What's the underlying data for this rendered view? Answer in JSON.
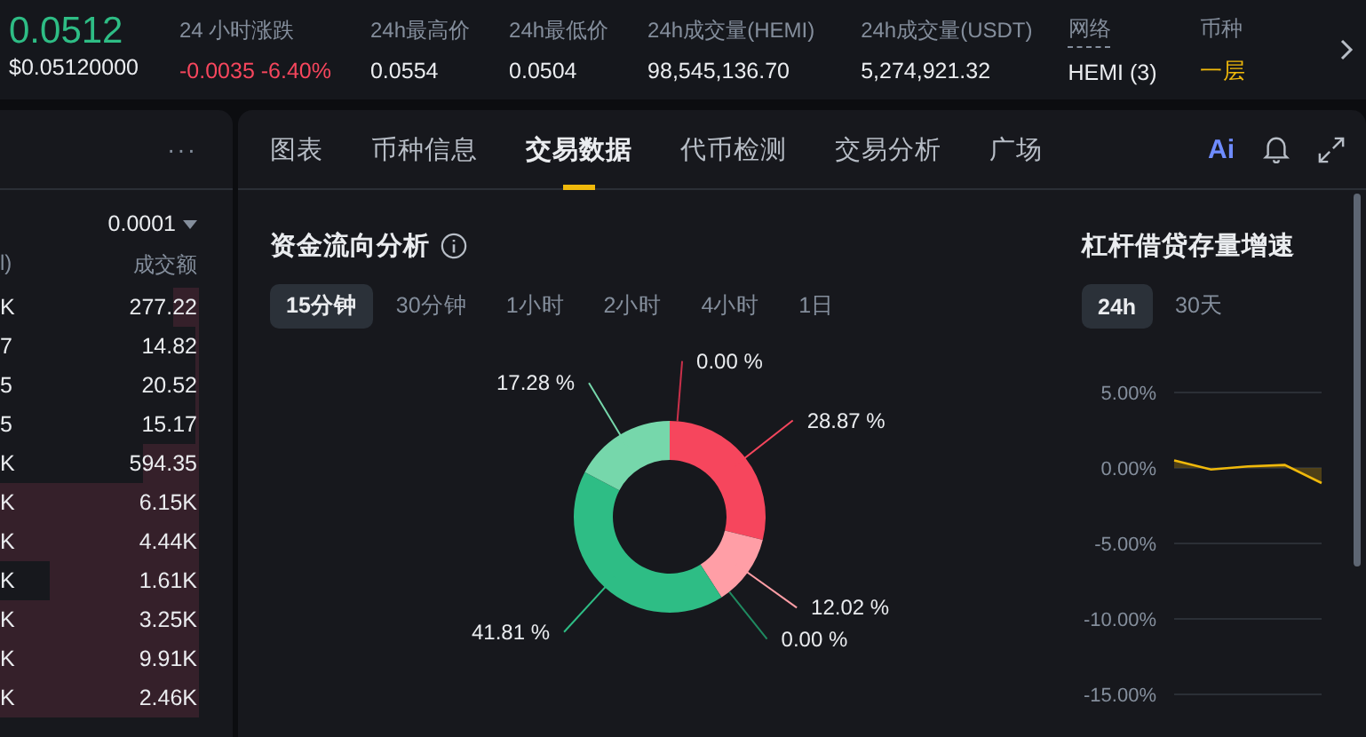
{
  "ticker": {
    "price": "0.0512",
    "price_usd": "$0.05120000"
  },
  "stats": [
    {
      "label": "24 小时涨跌",
      "value": "-0.0035 -6.40%",
      "kind": "down"
    },
    {
      "label": "24h最高价",
      "value": "0.0554",
      "kind": "plain"
    },
    {
      "label": "24h最低价",
      "value": "0.0504",
      "kind": "plain"
    },
    {
      "label": "24h成交量(HEMI)",
      "value": "98,545,136.70",
      "kind": "plain"
    },
    {
      "label": "24h成交量(USDT)",
      "value": "5,274,921.32",
      "kind": "plain"
    },
    {
      "label": "网络",
      "value": "HEMI (3)",
      "kind": "dotted"
    },
    {
      "label": "币种",
      "value": "一层",
      "kind": "accent"
    }
  ],
  "order_book": {
    "more": "···",
    "precision": "0.0001",
    "columns": [
      "l)",
      "成交额"
    ],
    "rows": [
      {
        "column_1": "K",
        "amount": "277.22"
      },
      {
        "column_1": "7",
        "amount": "14.82"
      },
      {
        "column_1": "5",
        "amount": "20.52"
      },
      {
        "column_1": "5",
        "amount": "15.17"
      },
      {
        "column_1": "K",
        "amount": "594.35"
      },
      {
        "column_1": "K",
        "amount": "6.15K"
      },
      {
        "column_1": "K",
        "amount": "4.44K"
      },
      {
        "column_1": "K",
        "amount": "1.61K"
      },
      {
        "column_1": "K",
        "amount": "3.25K"
      },
      {
        "column_1": "K",
        "amount": "9.91K"
      },
      {
        "column_1": "K",
        "amount": "2.46K"
      }
    ]
  },
  "tabs": [
    {
      "label": "图表",
      "selected": false
    },
    {
      "label": "币种信息",
      "selected": false
    },
    {
      "label": "交易数据",
      "selected": true
    },
    {
      "label": "代币检测",
      "selected": false
    },
    {
      "label": "交易分析",
      "selected": false
    },
    {
      "label": "广场",
      "selected": false
    }
  ],
  "ai_button": "Ai",
  "fund_flow": {
    "title": "资金流向分析",
    "periods": [
      {
        "label": "15分钟",
        "selected": true
      },
      {
        "label": "30分钟",
        "selected": false
      },
      {
        "label": "1小时",
        "selected": false
      },
      {
        "label": "2小时",
        "selected": false
      },
      {
        "label": "4小时",
        "selected": false
      },
      {
        "label": "1日",
        "selected": false
      }
    ],
    "chart_data": {
      "type": "donut",
      "value_labels": [
        "0.00 %",
        "28.87 %",
        "12.02 %",
        "0.00 %",
        "41.81 %",
        "17.28 %"
      ],
      "series": [
        {
          "colors": [
            "#c9304a",
            "#f6465d",
            "#ff9ea6",
            "#1f8a60",
            "#2ebd85",
            "#76d7ab"
          ],
          "values": [
            0.0,
            28.87,
            12.02,
            0.0,
            41.81,
            17.28
          ]
        }
      ]
    }
  },
  "margin_growth": {
    "title": "杠杆借贷存量增速",
    "periods": [
      {
        "label": "24h",
        "selected": true
      },
      {
        "label": "30天",
        "selected": false
      }
    ],
    "chart_data": {
      "type": "area",
      "grid": true,
      "ylim": [
        -15,
        5
      ],
      "yticks": [
        {
          "value": 5,
          "label": "5.00%"
        },
        {
          "value": 0,
          "label": "0.00%"
        },
        {
          "value": -5,
          "label": "-5.00%"
        },
        {
          "value": -10,
          "label": "-10.00%"
        },
        {
          "value": -15,
          "label": "-15.00%"
        }
      ],
      "series": [
        {
          "color": "#f0b90b",
          "values": [
            0.5,
            -0.1,
            0.1,
            0.2,
            -1.0
          ]
        }
      ]
    }
  }
}
